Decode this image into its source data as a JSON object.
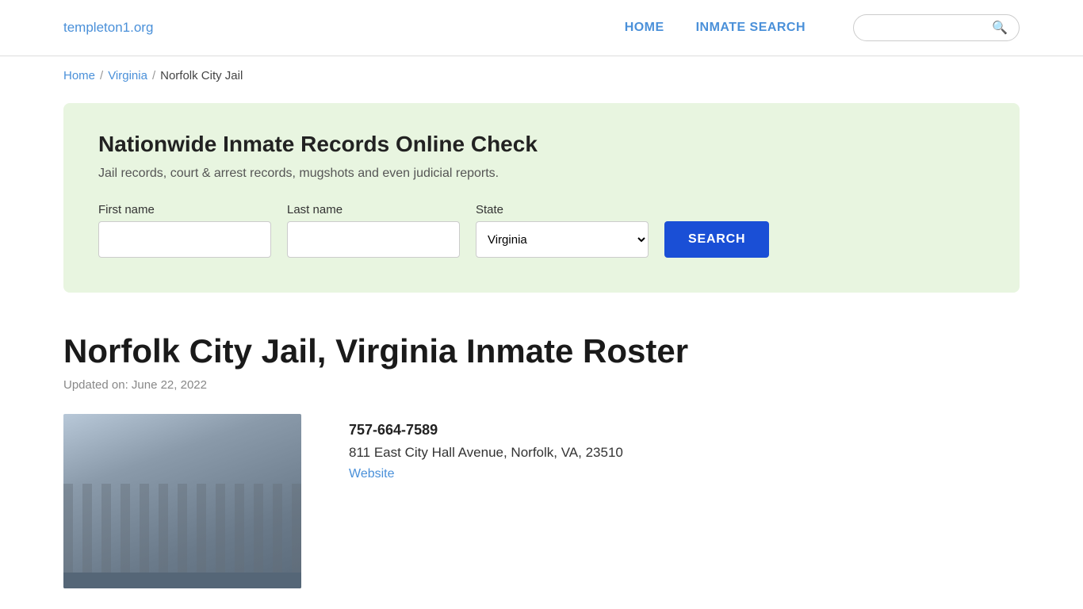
{
  "nav": {
    "logo": "templeton1.org",
    "links": [
      {
        "label": "HOME",
        "id": "home"
      },
      {
        "label": "INMATE SEARCH",
        "id": "inmate-search"
      }
    ],
    "search_placeholder": ""
  },
  "breadcrumb": {
    "home": "Home",
    "separator1": "/",
    "state": "Virginia",
    "separator2": "/",
    "current": "Norfolk City Jail"
  },
  "search_panel": {
    "title": "Nationwide Inmate Records Online Check",
    "description": "Jail records, court & arrest records, mugshots and even judicial reports.",
    "first_name_label": "First name",
    "last_name_label": "Last name",
    "state_label": "State",
    "state_value": "Virginia",
    "search_button": "SEARCH"
  },
  "page": {
    "title": "Norfolk City Jail, Virginia Inmate Roster",
    "updated": "Updated on: June 22, 2022"
  },
  "jail_info": {
    "phone": "757-664-7589",
    "address": "811 East City Hall Avenue, Norfolk, VA, 23510",
    "website_label": "Website"
  }
}
